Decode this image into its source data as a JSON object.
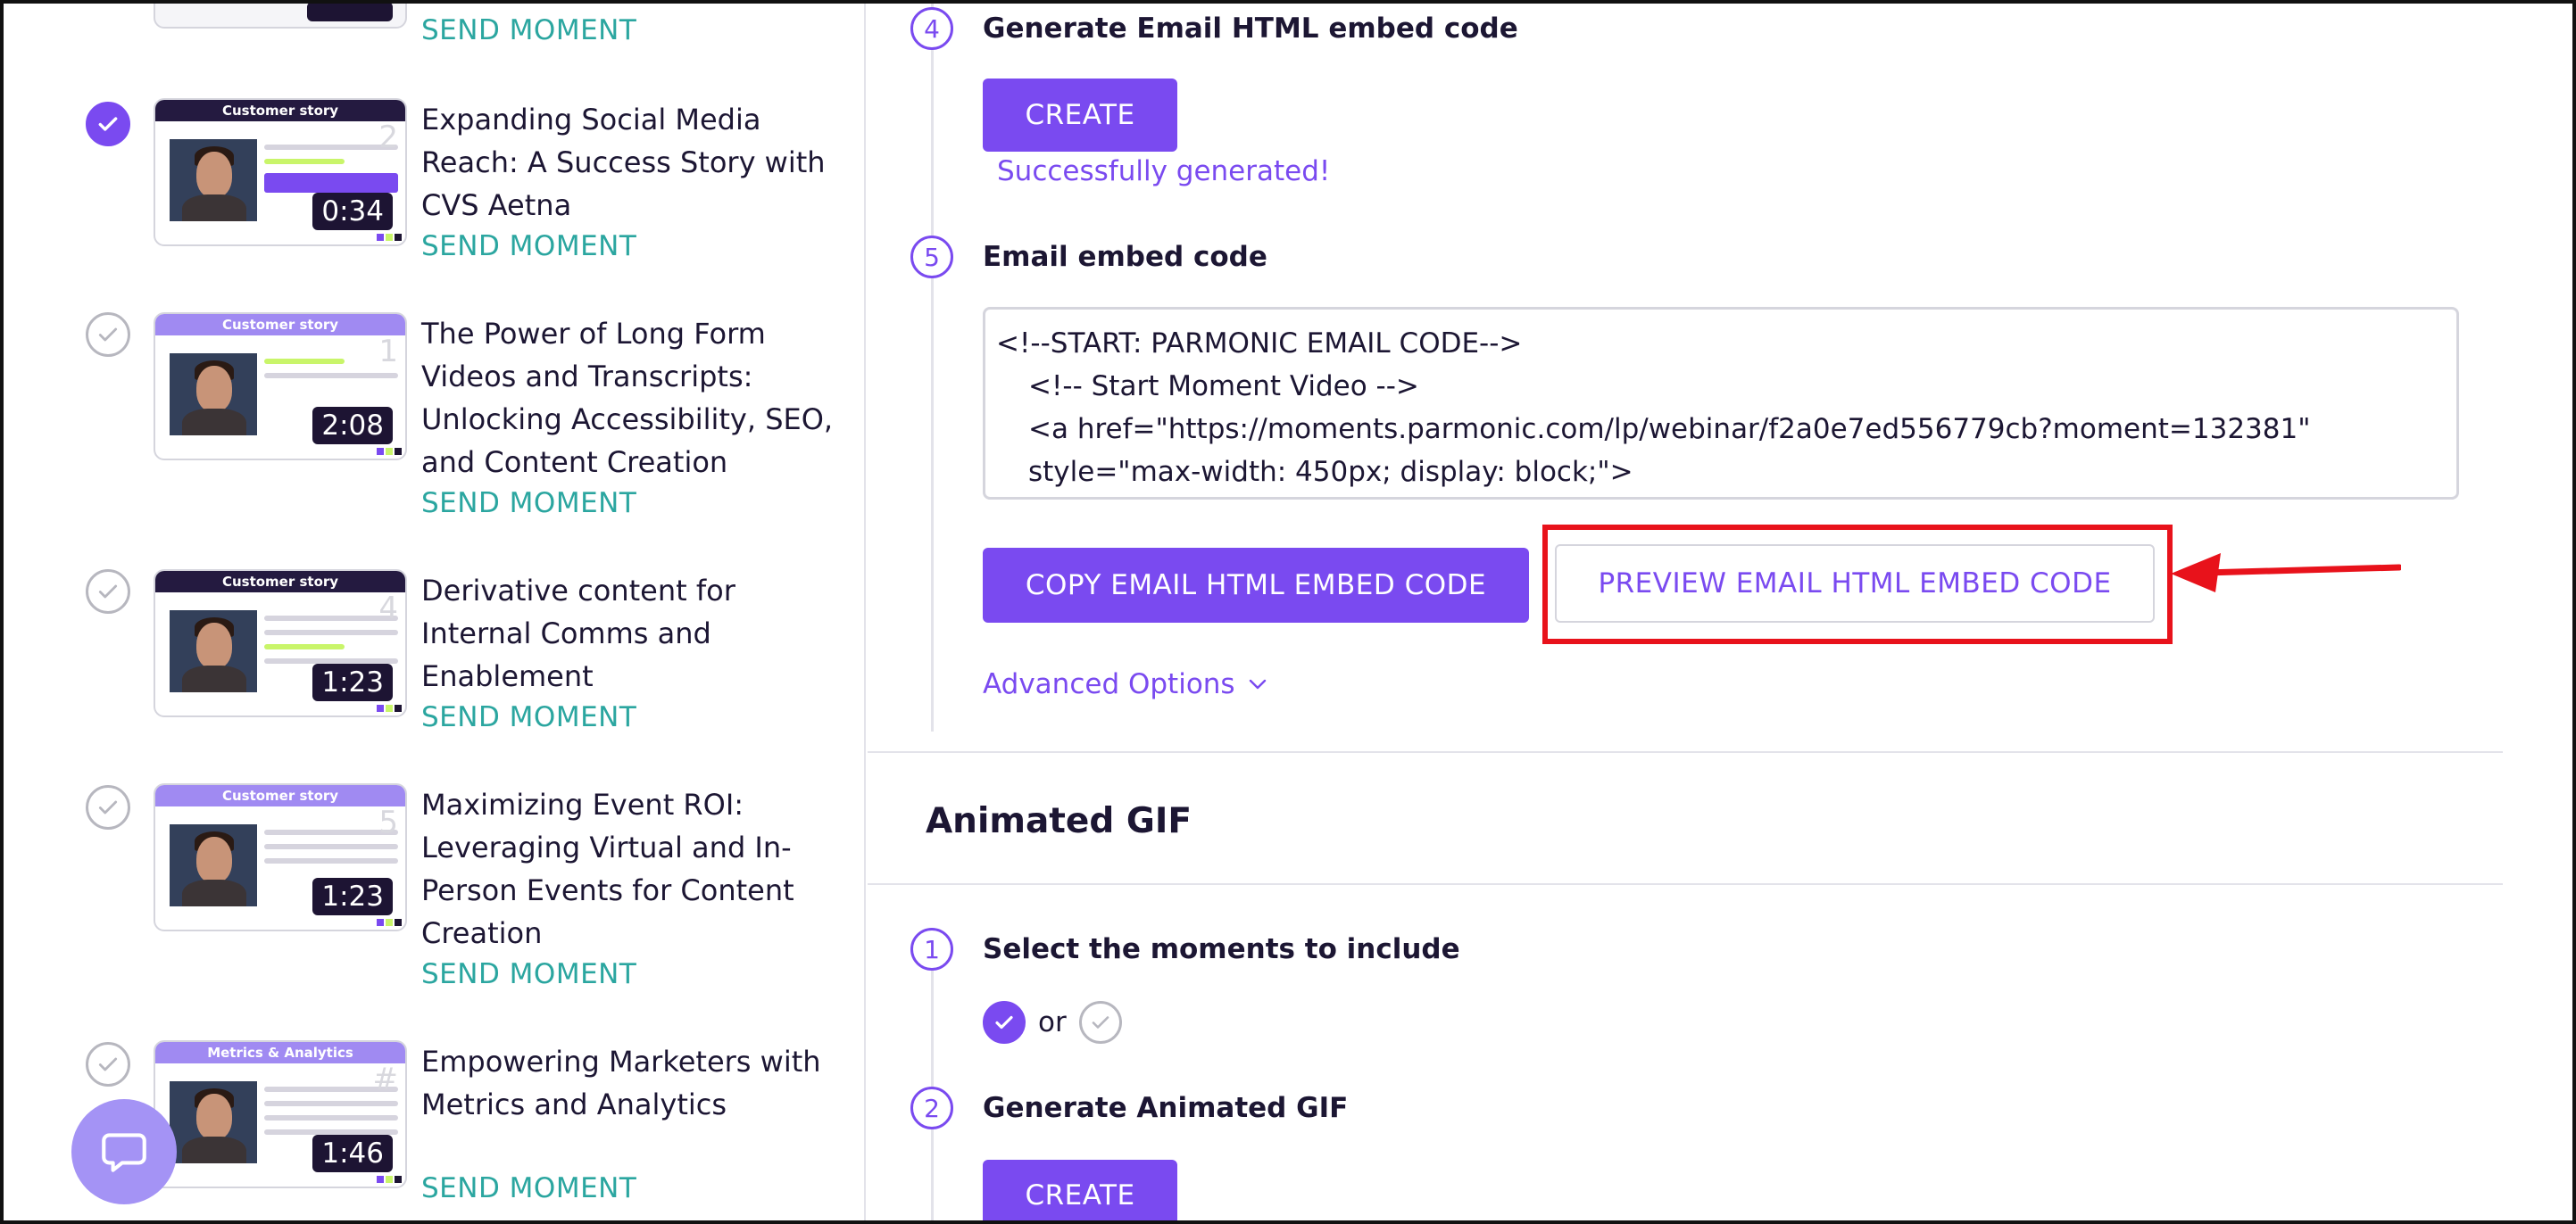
{
  "left_panel": {
    "top_send_label": "SEND MOMENT",
    "moments": [
      {
        "selected": true,
        "banner": "Customer story",
        "index": "2",
        "duration": "0:34",
        "title": "Expanding Social Media Reach: A Success Story with CVS Aetna",
        "send_label": "SEND MOMENT"
      },
      {
        "selected": false,
        "banner": "Customer story",
        "index": "1",
        "duration": "2:08",
        "title": "The Power of Long Form Videos and Transcripts: Unlocking Accessibility, SEO, and Content Creation",
        "send_label": "SEND MOMENT"
      },
      {
        "selected": false,
        "banner": "Customer story",
        "index": "4",
        "duration": "1:23",
        "title": "Derivative content for Internal Comms and Enablement",
        "send_label": "SEND MOMENT"
      },
      {
        "selected": false,
        "banner": "Customer story",
        "index": "5",
        "duration": "1:23",
        "title": "Maximizing Event ROI: Leveraging Virtual and In-Person Events for Content Creation",
        "send_label": "SEND MOMENT"
      },
      {
        "selected": false,
        "banner": "Metrics & Analytics",
        "index": "#",
        "duration": "1:46",
        "title": "Empowering Marketers with Metrics and Analytics",
        "send_label": "SEND MOMENT"
      }
    ]
  },
  "email_section": {
    "step4": {
      "number": "4",
      "title": "Generate Email HTML embed code",
      "button": "CREATE",
      "status": "Successfully generated!"
    },
    "step5": {
      "number": "5",
      "title": "Email embed code"
    },
    "code_lines": [
      "<!--START: PARMONIC EMAIL CODE-->",
      "<!-- Start Moment Video -->",
      "<a href=\"https://moments.parmonic.com/lp/webinar/f2a0e7ed556779cb?moment=132381\" style=\"max-width: 450px; display: block;\">"
    ],
    "copy_button": "COPY EMAIL HTML EMBED CODE",
    "preview_button": "PREVIEW EMAIL HTML EMBED CODE",
    "advanced_options": "Advanced Options"
  },
  "gif_section": {
    "title": "Animated GIF",
    "step1": {
      "number": "1",
      "title": "Select the moments to include"
    },
    "or_label": "or",
    "step2": {
      "number": "2",
      "title": "Generate Animated GIF",
      "button": "CREATE"
    }
  },
  "colors": {
    "accent": "#7a4af0",
    "send_moment": "#2ba6a0",
    "annotation_red": "#e8121b",
    "thumb_dark": "#1d1433"
  }
}
